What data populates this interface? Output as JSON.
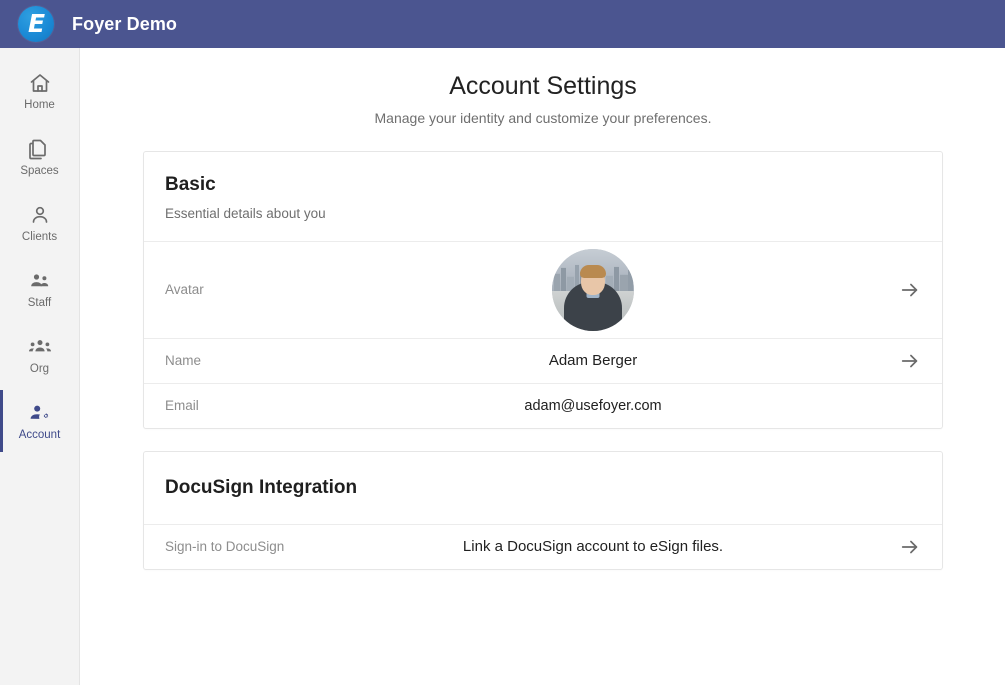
{
  "header": {
    "logo_letter": "E",
    "logo_icon": "foyer-logo-icon",
    "app_title": "Foyer Demo",
    "bar_color": "#4b5590",
    "logo_color": "#1b8ad6"
  },
  "sidebar": {
    "background": "#f3f3f3",
    "active_color": "#3f4a8a",
    "items": [
      {
        "label": "Home",
        "icon": "home-icon",
        "active": false
      },
      {
        "label": "Spaces",
        "icon": "documents-icon",
        "active": false
      },
      {
        "label": "Clients",
        "icon": "person-icon",
        "active": false
      },
      {
        "label": "Staff",
        "icon": "people-icon",
        "active": false
      },
      {
        "label": "Org",
        "icon": "group-icon",
        "active": false
      },
      {
        "label": "Account",
        "icon": "person-gear-icon",
        "active": true
      }
    ]
  },
  "page": {
    "title": "Account Settings",
    "subtitle": "Manage your identity and customize your preferences."
  },
  "cards": [
    {
      "title": "Basic",
      "subtitle": "Essential details about you",
      "rows": [
        {
          "label": "Avatar",
          "value": "",
          "type": "avatar",
          "arrow": true
        },
        {
          "label": "Name",
          "value": "Adam Berger",
          "type": "text",
          "arrow": true
        },
        {
          "label": "Email",
          "value": "adam@usefoyer.com",
          "type": "text",
          "arrow": false
        }
      ]
    },
    {
      "title": "DocuSign Integration",
      "subtitle": "",
      "rows": [
        {
          "label": "Sign-in to DocuSign",
          "value": "Link a DocuSign account to eSign files.",
          "type": "text",
          "arrow": true
        }
      ]
    }
  ],
  "icons": {
    "arrow_right": "arrow-right-icon"
  }
}
